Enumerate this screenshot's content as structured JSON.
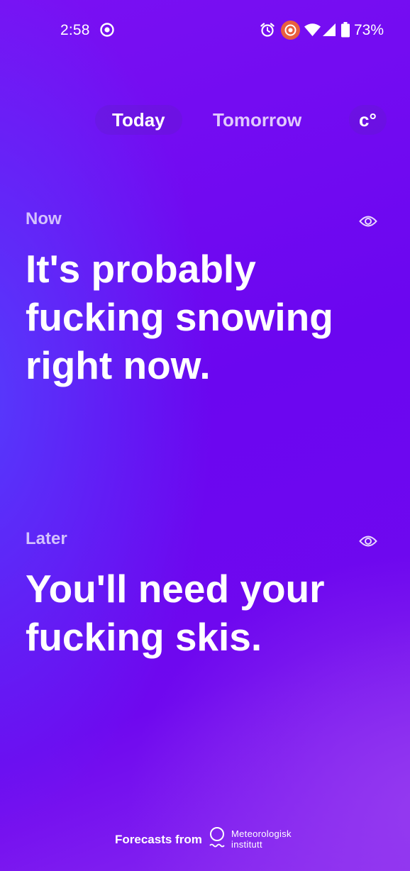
{
  "status_bar": {
    "time": "2:58",
    "battery_percent": "73%",
    "icons": [
      "screen-record-icon",
      "alarm-icon",
      "recording-indicator-icon",
      "wifi-icon",
      "cell-signal-icon",
      "battery-icon"
    ]
  },
  "tabs": [
    {
      "label": "Today",
      "selected": true
    },
    {
      "label": "Tomorrow",
      "selected": false
    }
  ],
  "unit_toggle": {
    "label": "c°"
  },
  "now": {
    "label": "Now",
    "headline": "It's probably fucking snowing right now.",
    "icon": "eye-icon"
  },
  "later": {
    "label": "Later",
    "headline": "You'll need your fucking skis.",
    "icon": "eye-icon"
  },
  "footer": {
    "prefix": "Forecasts from",
    "provider_line1": "Meteorologisk",
    "provider_line2": "institutt"
  },
  "colors": {
    "background_primary": "#6b06f0",
    "background_accent": "#8a2cf0",
    "record_indicator": "#e8603f",
    "text": "#ffffff"
  }
}
